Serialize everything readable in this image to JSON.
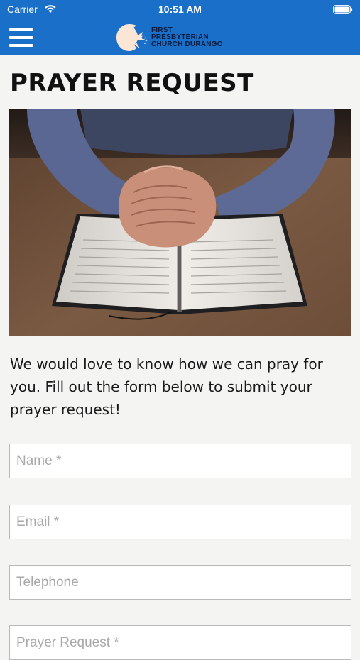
{
  "status_bar": {
    "carrier": "Carrier",
    "time": "10:51 AM"
  },
  "nav": {
    "menu_icon": "hamburger-menu-icon",
    "logo": {
      "line1": "FIRST",
      "line2": "PRESBYTERIAN",
      "line3": "CHURCH DURANGO"
    }
  },
  "page": {
    "title": "PRAYER REQUEST",
    "hero_image": "hands folded in prayer over an open bible",
    "intro": "We would love to know how we can pray for you.  Fill out the form below to submit your prayer request!"
  },
  "form": {
    "name_placeholder": "Name *",
    "email_placeholder": "Email *",
    "telephone_placeholder": "Telephone",
    "request_placeholder": "Prayer Request *"
  },
  "colors": {
    "header_blue": "#1a6fc8",
    "page_background": "#f4f4f2",
    "logo_text": "#0b1a3c"
  }
}
